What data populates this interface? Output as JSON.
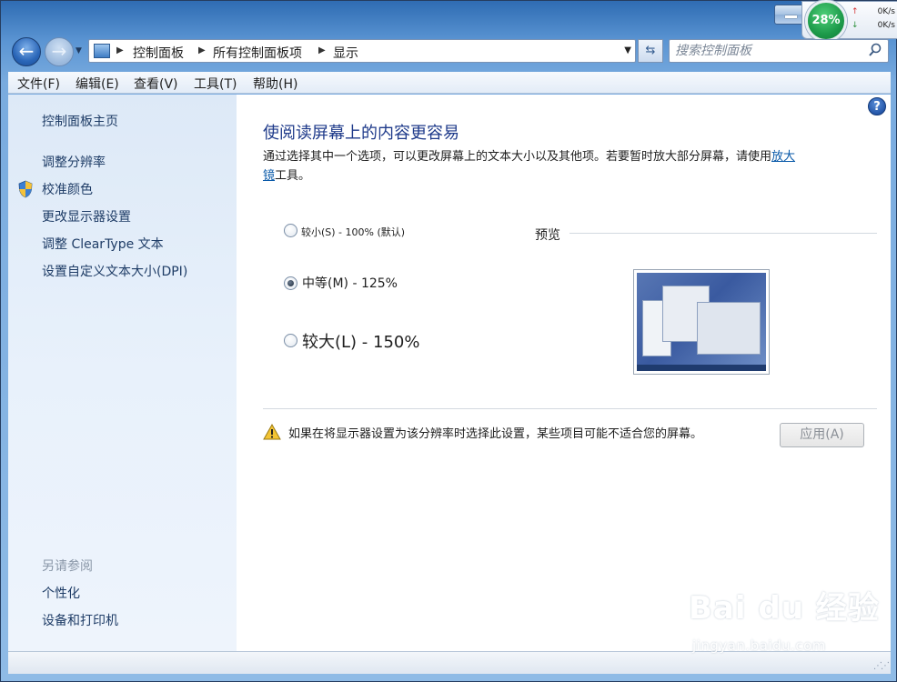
{
  "titlebar": {
    "net_monitor": {
      "cpu_percent": "28%",
      "upload": "0K/s",
      "download": "0K/s"
    }
  },
  "nav": {
    "breadcrumbs": [
      "控制面板",
      "所有控制面板项",
      "显示"
    ],
    "search_placeholder": "搜索控制面板"
  },
  "menu": [
    "文件(F)",
    "编辑(E)",
    "查看(V)",
    "工具(T)",
    "帮助(H)"
  ],
  "sidebar": {
    "home": "控制面板主页",
    "links": [
      "调整分辨率",
      "校准颜色",
      "更改显示器设置",
      "调整 ClearType 文本",
      "设置自定义文本大小(DPI)"
    ],
    "see_also_heading": "另请参阅",
    "see_also": [
      "个性化",
      "设备和打印机"
    ]
  },
  "main": {
    "title": "使阅读屏幕上的内容更容易",
    "description_part1": "通过选择其中一个选项，可以更改屏幕上的文本大小以及其他项。若要暂时放大部分屏幕，请使用",
    "description_link_a": "放大",
    "description_link_b": "镜",
    "description_part2": "工具。",
    "options": [
      {
        "label": "较小(S) - 100% (默认)",
        "selected": false
      },
      {
        "label": "中等(M) - 125%",
        "selected": true
      },
      {
        "label": "较大(L) - 150%",
        "selected": false
      }
    ],
    "preview_label": "预览",
    "warning": "如果在将显示器设置为该分辨率时选择此设置，某些项目可能不适合您的屏幕。",
    "apply_label": "应用(A)"
  },
  "watermark": {
    "main": "Bai du 经验",
    "sub": "jingyan.baidu.com"
  },
  "colors": {
    "title_blue": "#1e3a8a",
    "link_blue": "#0a5aa9",
    "cpu_green": "#1d9a4a"
  }
}
